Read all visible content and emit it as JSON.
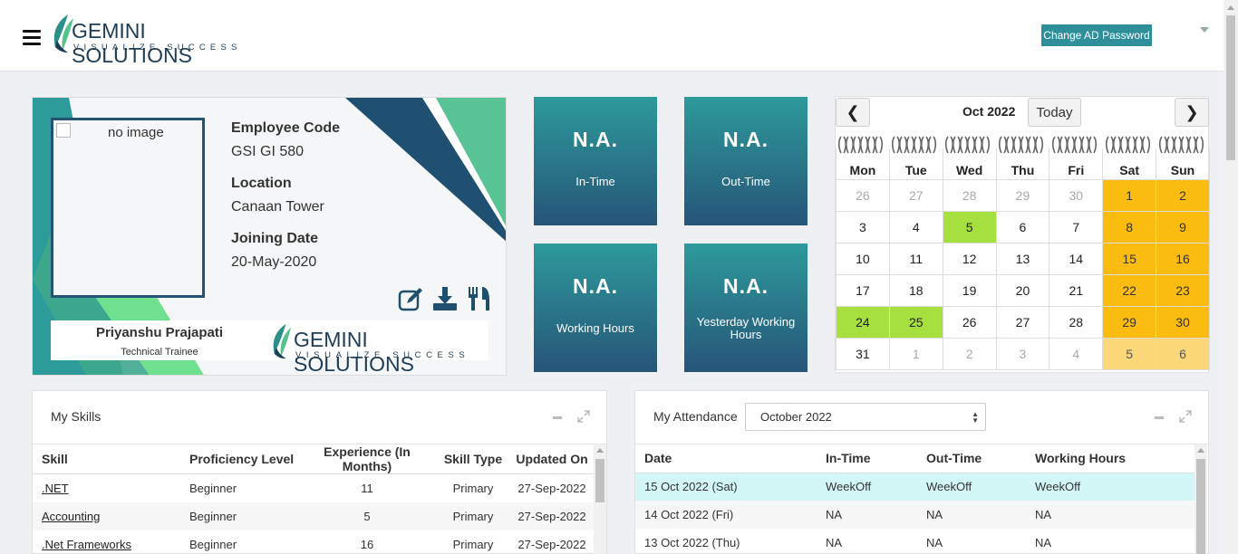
{
  "header": {
    "logo_main": "GEMINI SOLUTIONS",
    "logo_tagline": "VISUALIZE SUCCESS",
    "change_password_label": "Change AD Password"
  },
  "employee": {
    "photo_alt": "no image",
    "code_label": "Employee Code",
    "code_value": "GSI GI 580",
    "location_label": "Location",
    "location_value": "Canaan Tower",
    "joining_label": "Joining Date",
    "joining_value": "20-May-2020",
    "name": "Priyanshu Prajapati",
    "role": "Technical Trainee",
    "logo_main": "GEMINI SOLUTIONS",
    "logo_tagline": "VISUALIZE SUCCESS"
  },
  "tiles": [
    {
      "value": "N.A.",
      "label": "In-Time"
    },
    {
      "value": "N.A.",
      "label": "Out-Time"
    },
    {
      "value": "N.A.",
      "label": "Working Hours"
    },
    {
      "value": "N.A.",
      "label": "Yesterday Working Hours"
    }
  ],
  "calendar": {
    "prev": "❮",
    "next": "❯",
    "month": "Oct 2022",
    "today_label": "Today",
    "weekdays": [
      "Mon",
      "Tue",
      "Wed",
      "Thu",
      "Fri",
      "Sat",
      "Sun"
    ],
    "weeks": [
      [
        "26",
        "27",
        "28",
        "29",
        "30",
        "1",
        "2"
      ],
      [
        "3",
        "4",
        "5",
        "6",
        "7",
        "8",
        "9"
      ],
      [
        "10",
        "11",
        "12",
        "13",
        "14",
        "15",
        "16"
      ],
      [
        "17",
        "18",
        "19",
        "20",
        "21",
        "22",
        "23"
      ],
      [
        "24",
        "25",
        "26",
        "27",
        "28",
        "29",
        "30"
      ],
      [
        "31",
        "1",
        "2",
        "3",
        "4",
        "5",
        "6"
      ]
    ],
    "colors": {
      "weekend": "#fbbb0f",
      "present": "#a6e03e"
    }
  },
  "skills": {
    "title": "My Skills",
    "columns": [
      "Skill",
      "Proficiency Level",
      "Experience (In Months)",
      "Skill Type",
      "Updated On"
    ],
    "rows": [
      [
        ".NET",
        "Beginner",
        "11",
        "Primary",
        "27-Sep-2022"
      ],
      [
        "Accounting",
        "Beginner",
        "5",
        "Primary",
        "27-Sep-2022"
      ],
      [
        ".Net Frameworks",
        "Beginner",
        "16",
        "Primary",
        "27-Sep-2022"
      ]
    ]
  },
  "attendance": {
    "title": "My Attendance",
    "month_selected": "October 2022",
    "columns": [
      "Date",
      "In-Time",
      "Out-Time",
      "Working Hours"
    ],
    "rows": [
      [
        "15 Oct 2022 (Sat)",
        "WeekOff",
        "WeekOff",
        "WeekOff"
      ],
      [
        "14 Oct 2022 (Fri)",
        "NA",
        "NA",
        "NA"
      ],
      [
        "13 Oct 2022 (Thu)",
        "NA",
        "NA",
        "NA"
      ]
    ]
  }
}
